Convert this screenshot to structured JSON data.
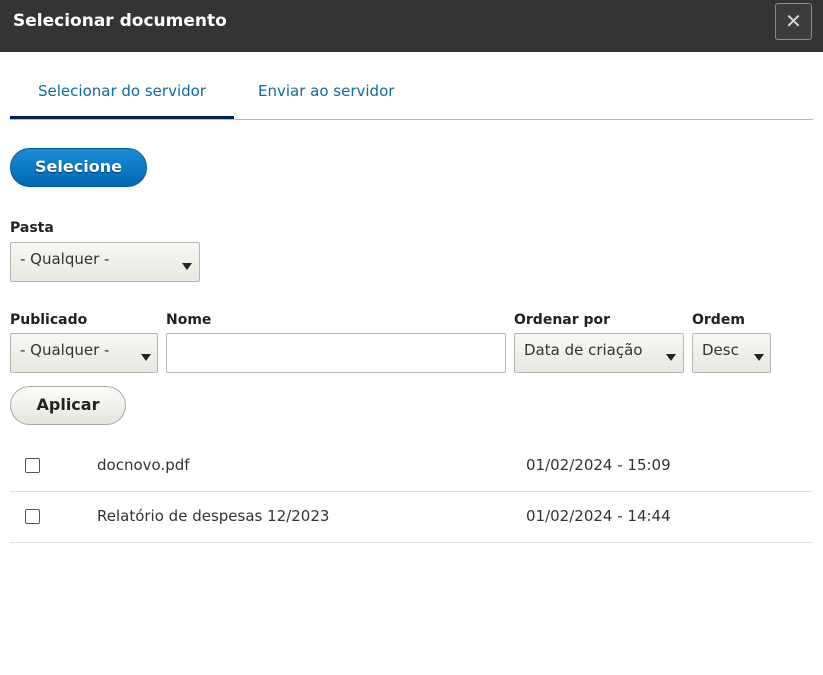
{
  "dialog": {
    "title": "Selecionar documento",
    "close_label": "✕"
  },
  "tabs": [
    {
      "label": "Selecionar do servidor",
      "active": true
    },
    {
      "label": "Enviar ao servidor",
      "active": false
    }
  ],
  "select_button_label": "Selecione",
  "filters": {
    "pasta": {
      "label": "Pasta",
      "value": "- Qualquer -"
    },
    "publicado": {
      "label": "Publicado",
      "value": "- Qualquer -"
    },
    "nome": {
      "label": "Nome",
      "value": ""
    },
    "ordenar_por": {
      "label": "Ordenar por",
      "value": "Data de criação"
    },
    "ordem": {
      "label": "Ordem",
      "value": "Desc"
    }
  },
  "apply_button_label": "Aplicar",
  "documents": [
    {
      "name": "docnovo.pdf",
      "date": "01/02/2024 - 15:09",
      "checked": false
    },
    {
      "name": "Relatório de despesas 12/2023",
      "date": "01/02/2024 - 14:44",
      "checked": false
    }
  ],
  "colors": {
    "titlebar": "#343434",
    "accent": "#0a6aab",
    "tab_underline": "#00205b",
    "primary_button": "#0074c8"
  }
}
